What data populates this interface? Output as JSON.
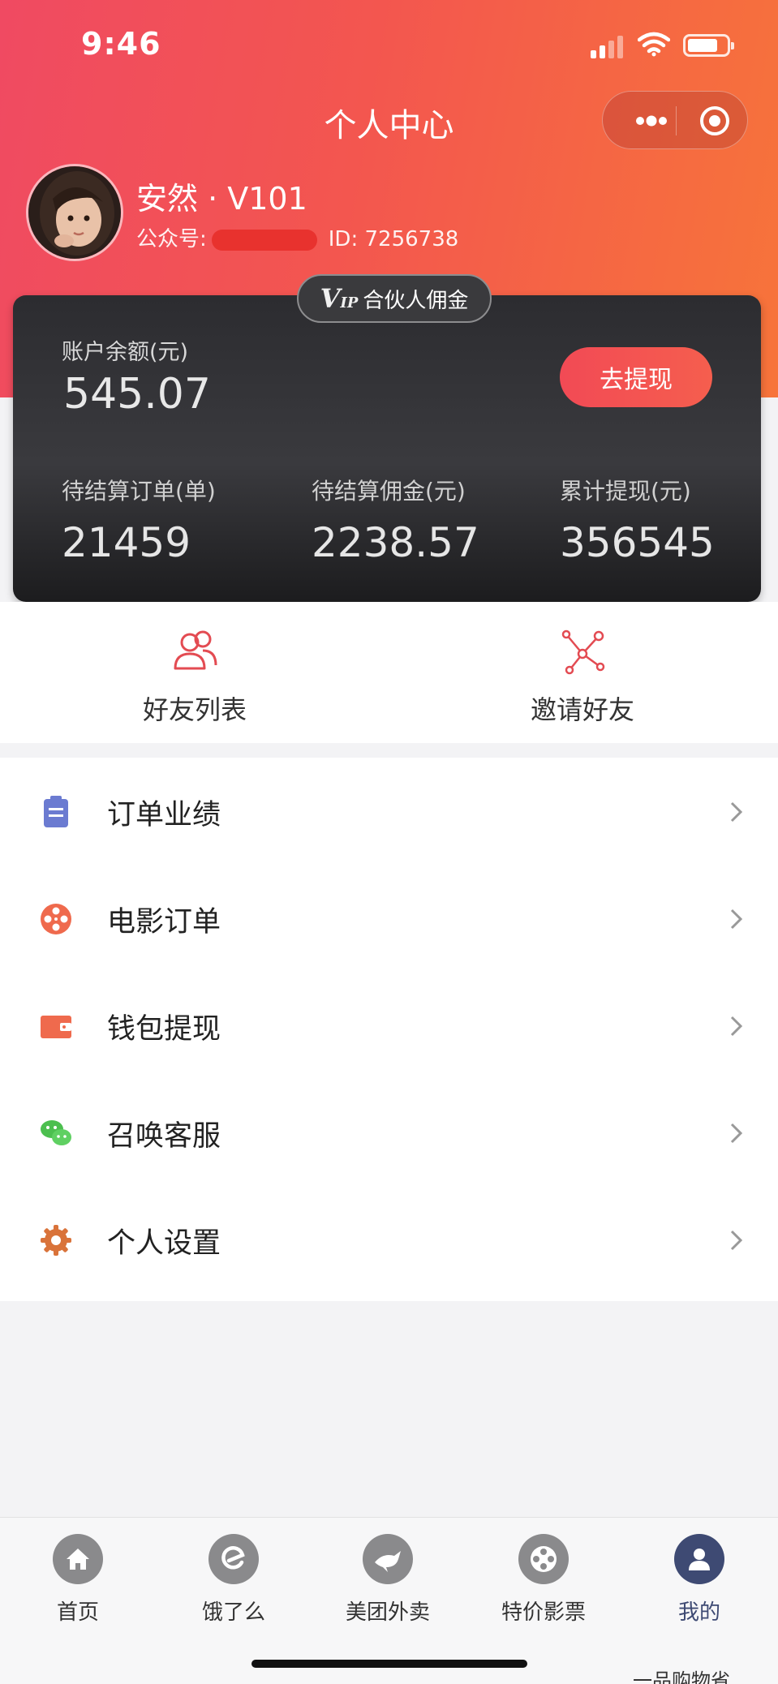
{
  "status_bar": {
    "time": "9:46"
  },
  "nav": {
    "title": "个人中心"
  },
  "profile": {
    "name": "安然 · V101",
    "official_label": "公众号:",
    "id_text": "ID: 7256738"
  },
  "card": {
    "badge_mark": "V",
    "badge_mark_sub": "IP",
    "badge_text": "合伙人佣金",
    "balance_label": "账户余额(元)",
    "balance_value": "545.07",
    "withdraw_label": "去提现",
    "stats": [
      {
        "label": "待结算订单(单)",
        "value": "21459"
      },
      {
        "label": "待结算佣金(元)",
        "value": "2238.57"
      },
      {
        "label": "累计提现(元)",
        "value": "356545"
      }
    ]
  },
  "quick_actions": [
    {
      "label": "好友列表",
      "icon": "friends-icon"
    },
    {
      "label": "邀请好友",
      "icon": "invite-network-icon"
    }
  ],
  "menu": [
    {
      "label": "订单业绩",
      "icon": "clipboard-icon",
      "color": "#6b7bd1"
    },
    {
      "label": "电影订单",
      "icon": "film-reel-icon",
      "color": "#ef6a4d"
    },
    {
      "label": "钱包提现",
      "icon": "wallet-icon",
      "color": "#ef6a4d"
    },
    {
      "label": "召唤客服",
      "icon": "wechat-icon",
      "color": "#4cbf4f"
    },
    {
      "label": "个人设置",
      "icon": "gear-icon",
      "color": "#d9733a"
    }
  ],
  "tabbar": [
    {
      "label": "首页",
      "icon": "home-icon"
    },
    {
      "label": "饿了么",
      "icon": "eleme-icon"
    },
    {
      "label": "美团外卖",
      "icon": "kangaroo-icon"
    },
    {
      "label": "特价影票",
      "icon": "film-reel-icon"
    },
    {
      "label": "我的",
      "icon": "user-icon",
      "active": true
    }
  ],
  "watermark": "一品购物省",
  "colors": {
    "header_start": "#f04a62",
    "header_end": "#f7743a",
    "card_bg": "#2c2c30",
    "accent": "#f24a55",
    "active_tab": "#3e4a73"
  }
}
